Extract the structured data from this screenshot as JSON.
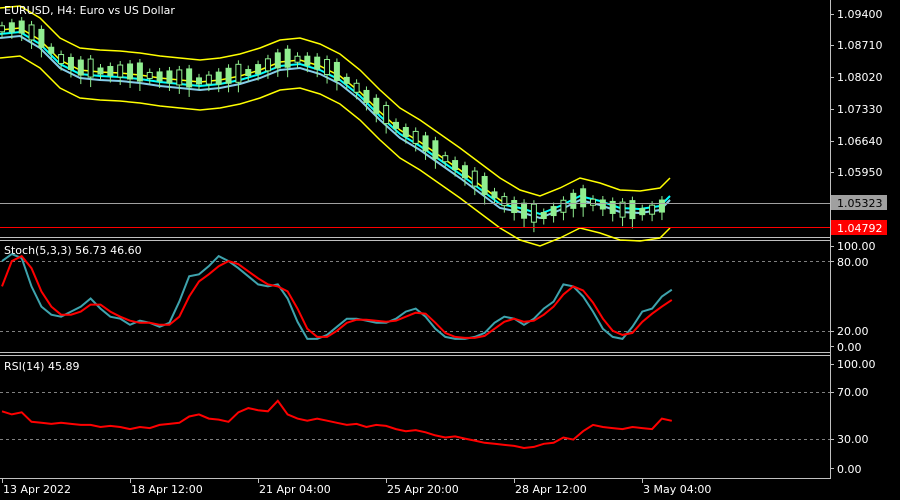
{
  "main_panel": {
    "title": "EURUSD, H4:  Euro vs US Dollar",
    "price_labels": [
      "1.09400",
      "1.08710",
      "1.08020",
      "1.07330",
      "1.06640",
      "1.05950"
    ],
    "bid_label": "1.05323",
    "marker_label": "1.04792",
    "hline_bid_color": "#a0a0a0",
    "hline_marker_color": "#ff0000"
  },
  "stoch_panel": {
    "label": "Stoch(5,3,3) 56.73 46.60",
    "levels": [
      "100.00",
      "80.00",
      "20.00",
      "0.00"
    ],
    "main_color": "#3ea3ad",
    "signal_color": "#ff0000"
  },
  "rsi_panel": {
    "label": "RSI(14) 45.89",
    "levels": [
      "100.00",
      "70.00",
      "30.00",
      "0.00"
    ],
    "line_color": "#ff0000"
  },
  "time_axis": {
    "labels": [
      "13 Apr 2022",
      "18 Apr 12:00",
      "21 Apr 04:00",
      "25 Apr 20:00",
      "28 Apr 12:00",
      "3 May 04:00"
    ]
  },
  "colors": {
    "bull_candle": "#90ee90",
    "bear_candle": "#90ee90",
    "bollinger": "#ffff00",
    "ma_fast": "#00ffff",
    "ma_slow": "#ffff00",
    "grid_dots": "#808080",
    "axis": "#c0c0c0"
  },
  "chart_data": {
    "type": "candlestick",
    "stoch_main": [
      85,
      92,
      88,
      60,
      40,
      32,
      30,
      35,
      40,
      48,
      38,
      30,
      28,
      22,
      26,
      24,
      20,
      24,
      45,
      70,
      72,
      80,
      90,
      85,
      78,
      70,
      62,
      60,
      62,
      48,
      25,
      8,
      8,
      12,
      20,
      28,
      28,
      26,
      24,
      24,
      28,
      35,
      38,
      30,
      18,
      10,
      8,
      8,
      10,
      14,
      24,
      30,
      28,
      22,
      28,
      38,
      45,
      62,
      60,
      50,
      35,
      18,
      10,
      8,
      20,
      35,
      38,
      50,
      56.73
    ],
    "stoch_signal": [
      60,
      85,
      90,
      78,
      55,
      40,
      32,
      32,
      35,
      42,
      42,
      35,
      30,
      26,
      24,
      24,
      22,
      22,
      30,
      50,
      65,
      72,
      80,
      85,
      82,
      75,
      68,
      62,
      60,
      55,
      38,
      18,
      10,
      10,
      16,
      24,
      27,
      27,
      26,
      25,
      26,
      30,
      34,
      33,
      24,
      14,
      10,
      9,
      9,
      11,
      18,
      25,
      28,
      25,
      26,
      32,
      40,
      52,
      60,
      56,
      44,
      28,
      16,
      12,
      14,
      25,
      33,
      40,
      46.6
    ],
    "rsi": [
      55,
      52,
      54,
      45,
      44,
      43,
      44,
      43,
      42,
      42,
      40,
      41,
      40,
      38,
      40,
      39,
      42,
      43,
      44,
      50,
      52,
      48,
      47,
      45,
      54,
      58,
      56,
      55,
      65,
      52,
      48,
      46,
      48,
      46,
      44,
      42,
      43,
      40,
      42,
      41,
      38,
      36,
      37,
      35,
      32,
      30,
      31,
      29,
      27,
      25,
      24,
      23,
      22,
      20,
      21,
      24,
      25,
      30,
      28,
      36,
      42,
      40,
      39,
      38,
      40,
      39,
      38,
      48,
      45.89
    ]
  }
}
